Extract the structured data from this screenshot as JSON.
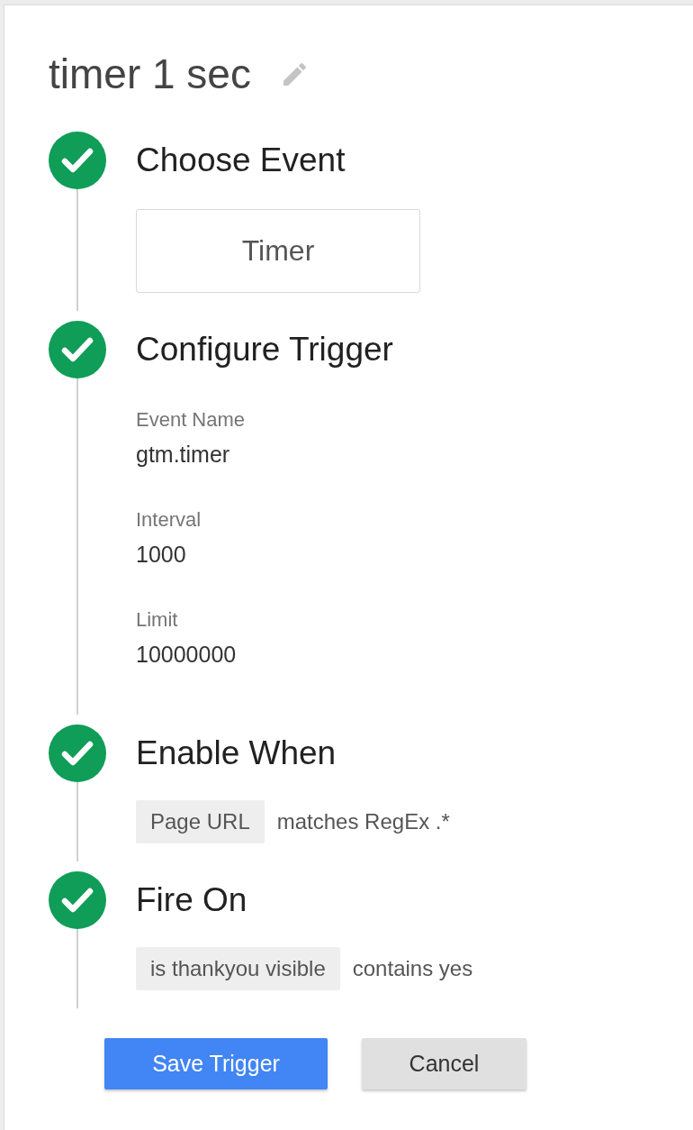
{
  "trigger": {
    "title": "timer 1 sec"
  },
  "steps": [
    {
      "title": "Choose Event",
      "complete": true,
      "kind": "choice",
      "choice": "Timer"
    },
    {
      "title": "Configure Trigger",
      "complete": true,
      "kind": "fields",
      "fields": [
        {
          "label": "Event Name",
          "value": "gtm.timer"
        },
        {
          "label": "Interval",
          "value": "1000"
        },
        {
          "label": "Limit",
          "value": "10000000"
        }
      ]
    },
    {
      "title": "Enable When",
      "complete": true,
      "kind": "conditions",
      "conditions": [
        {
          "variable": "Page URL",
          "rule": "matches RegEx .*"
        }
      ]
    },
    {
      "title": "Fire On",
      "complete": true,
      "kind": "conditions",
      "conditions": [
        {
          "variable": "is thankyou visible",
          "rule": "contains yes"
        }
      ]
    }
  ],
  "buttons": [
    {
      "label": "Save Trigger",
      "kind": "primary"
    },
    {
      "label": "Cancel",
      "kind": "secondary"
    }
  ]
}
